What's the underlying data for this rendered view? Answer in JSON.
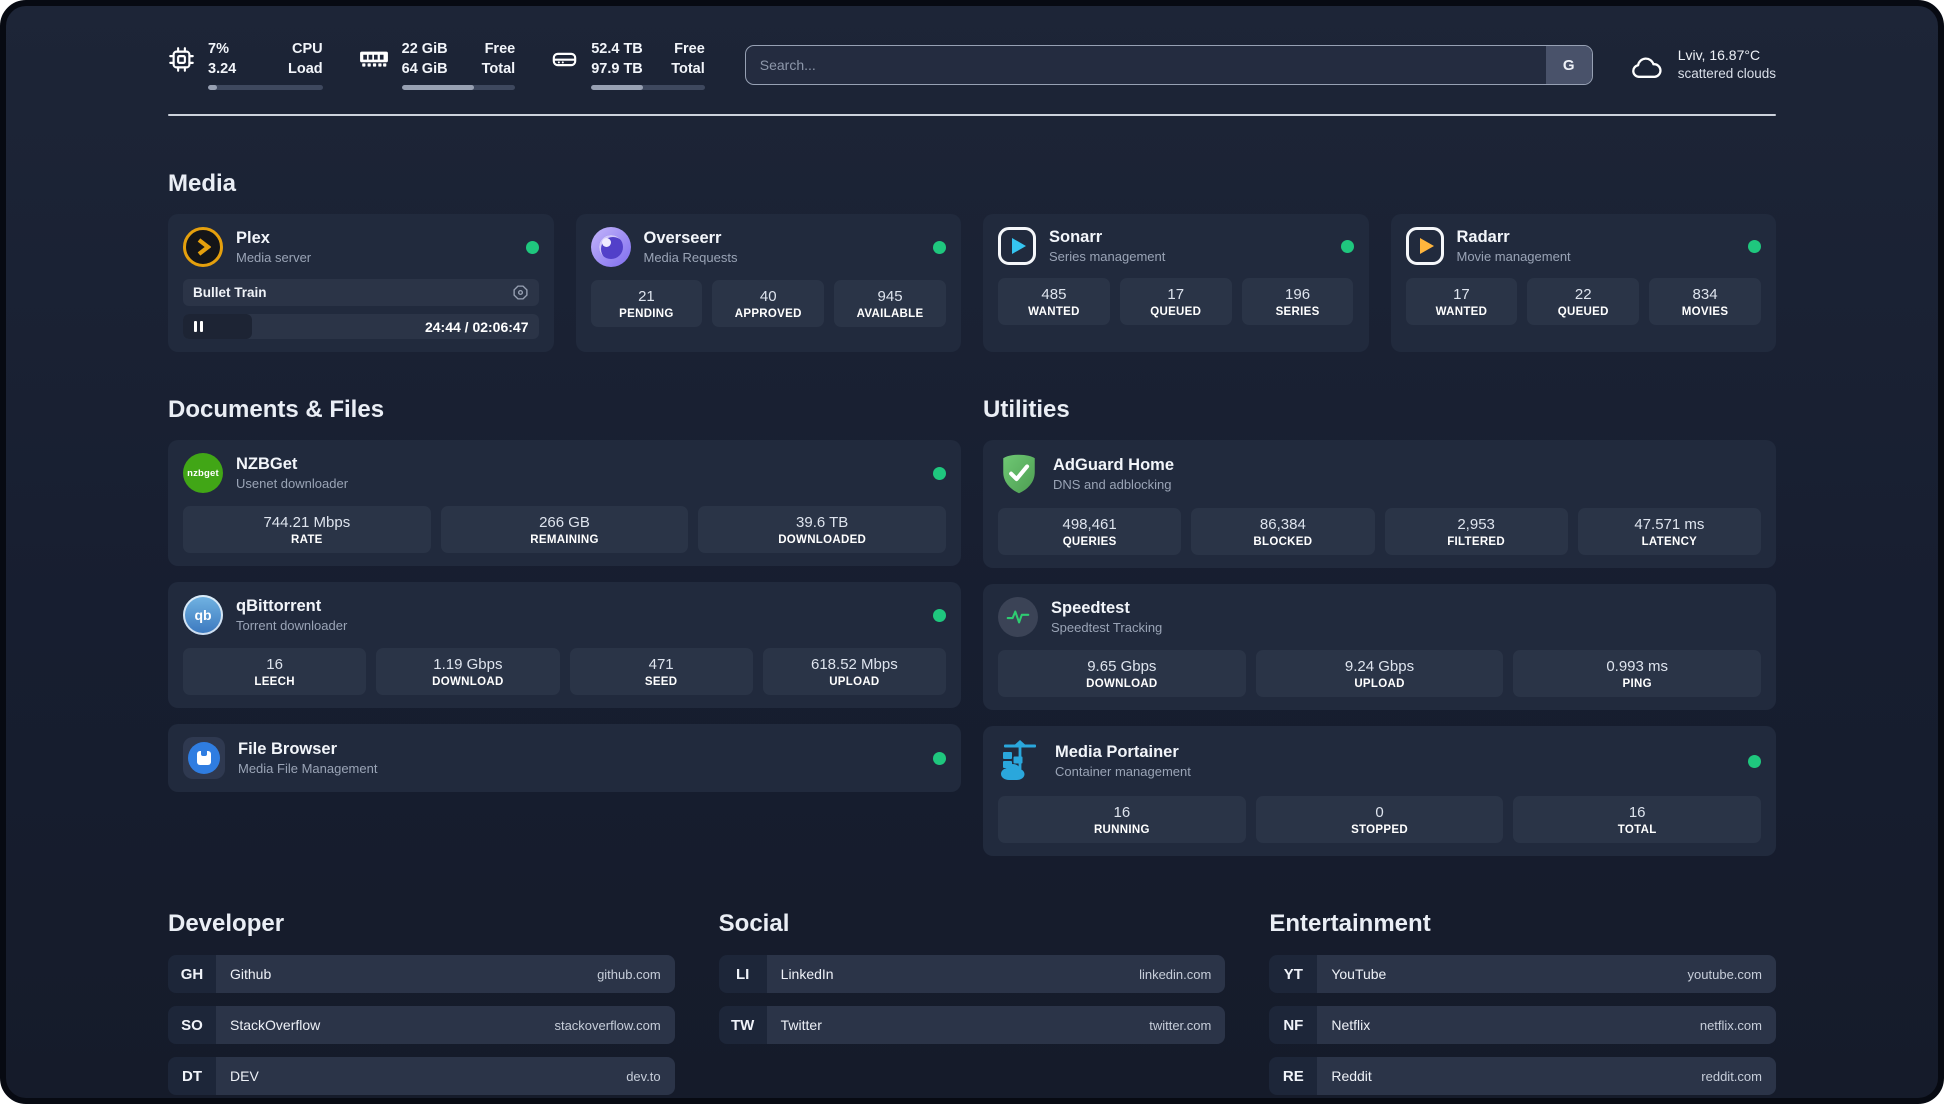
{
  "header": {
    "metrics": [
      {
        "id": "cpu",
        "icon": "cpu-icon",
        "values": [
          "7%",
          "3.24"
        ],
        "labels": [
          "CPU",
          "Load"
        ],
        "progress_pct": 8
      },
      {
        "id": "memory",
        "icon": "memory-icon",
        "values": [
          "22 GiB",
          "64 GiB"
        ],
        "labels": [
          "Free",
          "Total"
        ],
        "progress_pct": 64
      },
      {
        "id": "disk",
        "icon": "disk-icon",
        "values": [
          "52.4 TB",
          "97.9 TB"
        ],
        "labels": [
          "Free",
          "Total"
        ],
        "progress_pct": 46
      }
    ],
    "search": {
      "placeholder": "Search...",
      "engine_button": "G"
    },
    "weather": {
      "icon": "cloud-icon",
      "location_temp": "Lviv, 16.87°C",
      "condition": "scattered clouds"
    }
  },
  "media_section": {
    "title": "Media",
    "cards": [
      {
        "app": "plex",
        "icon": "plex-icon",
        "title": "Plex",
        "subtitle": "Media server",
        "status_online": true,
        "now_playing": {
          "title": "Bullet Train",
          "icon": "transcode-icon",
          "elapsed": "24:44",
          "separator": " / ",
          "duration": "02:06:47",
          "progress_pct": 19.5
        }
      },
      {
        "app": "overseerr",
        "icon": "overseerr-icon",
        "title": "Overseerr",
        "subtitle": "Media Requests",
        "status_online": true,
        "stats": [
          {
            "value": "21",
            "label": "PENDING"
          },
          {
            "value": "40",
            "label": "APPROVED"
          },
          {
            "value": "945",
            "label": "AVAILABLE"
          }
        ]
      },
      {
        "app": "sonarr",
        "icon": "sonarr-icon",
        "title": "Sonarr",
        "subtitle": "Series management",
        "status_online": true,
        "stats": [
          {
            "value": "485",
            "label": "WANTED"
          },
          {
            "value": "17",
            "label": "QUEUED"
          },
          {
            "value": "196",
            "label": "SERIES"
          }
        ]
      },
      {
        "app": "radarr",
        "icon": "radarr-icon",
        "title": "Radarr",
        "subtitle": "Movie management",
        "status_online": true,
        "stats": [
          {
            "value": "17",
            "label": "WANTED"
          },
          {
            "value": "22",
            "label": "QUEUED"
          },
          {
            "value": "834",
            "label": "MOVIES"
          }
        ]
      }
    ]
  },
  "columns": [
    {
      "title": "Documents & Files",
      "cards": [
        {
          "app": "nzbget",
          "icon": "nzbget-icon",
          "title": "NZBGet",
          "subtitle": "Usenet downloader",
          "status_online": true,
          "stats": [
            {
              "value": "744.21 Mbps",
              "label": "RATE"
            },
            {
              "value": "266 GB",
              "label": "REMAINING"
            },
            {
              "value": "39.6 TB",
              "label": "DOWNLOADED"
            }
          ]
        },
        {
          "app": "qbittorrent",
          "icon": "qbittorrent-icon",
          "title": "qBittorrent",
          "subtitle": "Torrent downloader",
          "status_online": true,
          "stats": [
            {
              "value": "16",
              "label": "LEECH"
            },
            {
              "value": "1.19 Gbps",
              "label": "DOWNLOAD"
            },
            {
              "value": "471",
              "label": "SEED"
            },
            {
              "value": "618.52 Mbps",
              "label": "UPLOAD"
            }
          ]
        },
        {
          "app": "filebrowser",
          "icon": "filebrowser-icon",
          "title": "File Browser",
          "subtitle": "Media File Management",
          "status_online": true
        }
      ]
    },
    {
      "title": "Utilities",
      "cards": [
        {
          "app": "adguard",
          "icon": "adguard-icon",
          "title": "AdGuard Home",
          "subtitle": "DNS and adblocking",
          "status_online": false,
          "stats": [
            {
              "value": "498,461",
              "label": "QUERIES"
            },
            {
              "value": "86,384",
              "label": "BLOCKED"
            },
            {
              "value": "2,953",
              "label": "FILTERED"
            },
            {
              "value": "47.571 ms",
              "label": "LATENCY"
            }
          ]
        },
        {
          "app": "speedtest",
          "icon": "speedtest-icon",
          "title": "Speedtest",
          "subtitle": "Speedtest Tracking",
          "status_online": false,
          "stats": [
            {
              "value": "9.65 Gbps",
              "label": "DOWNLOAD"
            },
            {
              "value": "9.24 Gbps",
              "label": "UPLOAD"
            },
            {
              "value": "0.993 ms",
              "label": "PING"
            }
          ]
        },
        {
          "app": "portainer",
          "icon": "portainer-icon",
          "title": "Media Portainer",
          "subtitle": "Container management",
          "status_online": true,
          "stats": [
            {
              "value": "16",
              "label": "RUNNING"
            },
            {
              "value": "0",
              "label": "STOPPED"
            },
            {
              "value": "16",
              "label": "TOTAL"
            }
          ]
        }
      ]
    }
  ],
  "bookmark_groups": [
    {
      "title": "Developer",
      "links": [
        {
          "abbr": "GH",
          "name": "Github",
          "url": "github.com"
        },
        {
          "abbr": "SO",
          "name": "StackOverflow",
          "url": "stackoverflow.com"
        },
        {
          "abbr": "DT",
          "name": "DEV",
          "url": "dev.to"
        }
      ]
    },
    {
      "title": "Social",
      "links": [
        {
          "abbr": "LI",
          "name": "LinkedIn",
          "url": "linkedin.com"
        },
        {
          "abbr": "TW",
          "name": "Twitter",
          "url": "twitter.com"
        }
      ]
    },
    {
      "title": "Entertainment",
      "links": [
        {
          "abbr": "YT",
          "name": "YouTube",
          "url": "youtube.com"
        },
        {
          "abbr": "NF",
          "name": "Netflix",
          "url": "netflix.com"
        },
        {
          "abbr": "RE",
          "name": "Reddit",
          "url": "reddit.com"
        }
      ]
    }
  ],
  "colors": {
    "status_online": "#1fc77e",
    "plex_accent": "#e5a00d",
    "sonarr_accent": "#35c5f1",
    "radarr_accent": "#ffb53d",
    "page_bg": "#171e30",
    "card_bg": "#212a3d",
    "stat_bg": "#2a3447"
  }
}
